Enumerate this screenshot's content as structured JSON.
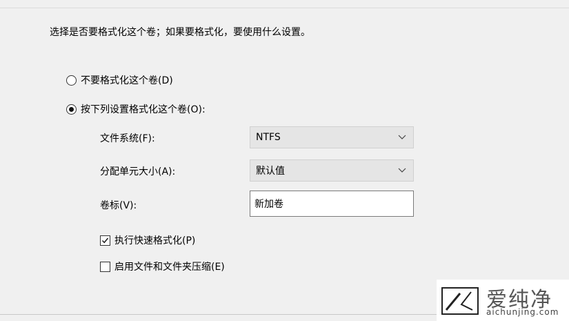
{
  "dialog": {
    "instruction": "选择是否要格式化这个卷；如果要格式化，要使用什么设置。",
    "option_no_format": {
      "label": "不要格式化这个卷(D)",
      "selected": false
    },
    "option_format": {
      "label": "按下列设置格式化这个卷(O):",
      "selected": true
    },
    "file_system": {
      "label": "文件系统(F):",
      "value": "NTFS"
    },
    "allocation_unit": {
      "label": "分配单元大小(A):",
      "value": "默认值"
    },
    "volume_label": {
      "label": "卷标(V):",
      "value": "新加卷"
    },
    "quick_format": {
      "label": "执行快速格式化(P)",
      "checked": true
    },
    "compression": {
      "label": "启用文件和文件夹压缩(E)",
      "checked": false
    }
  },
  "watermark": {
    "brand": "爱纯净",
    "url": "aichunjing.com"
  }
}
